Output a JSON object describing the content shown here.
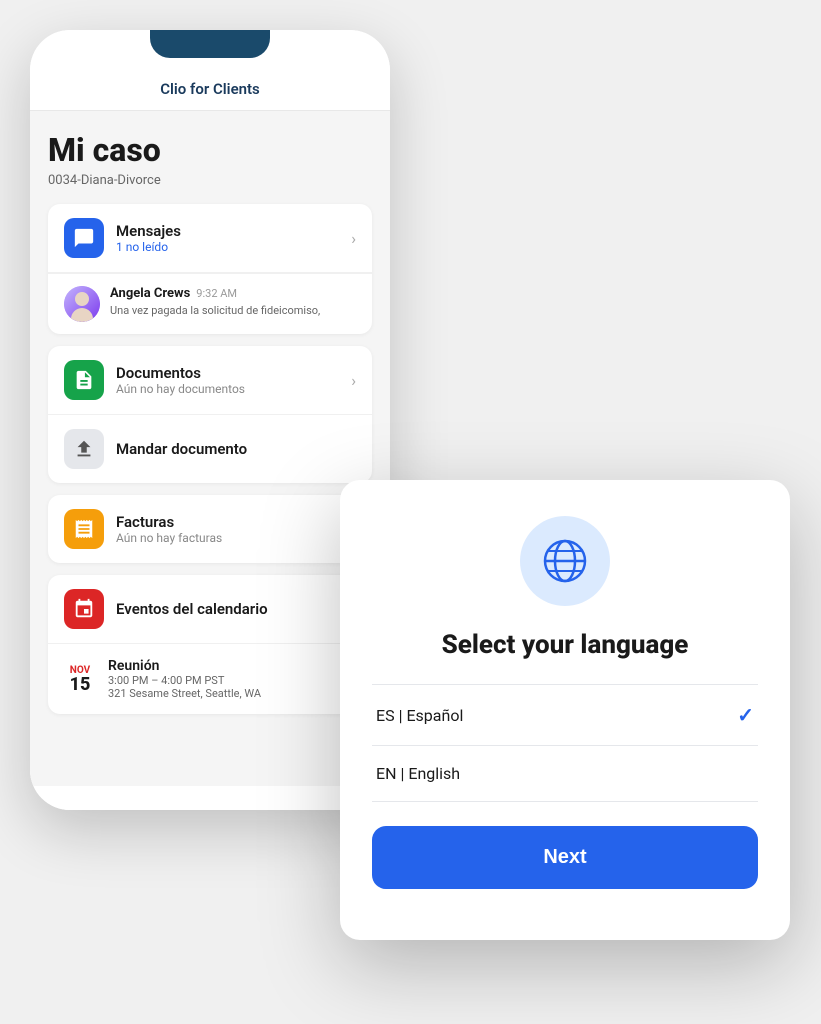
{
  "phone": {
    "header_title": "Clio for Clients",
    "case_title": "Mi caso",
    "case_subtitle": "0034-Diana-Divorce",
    "cards": {
      "mensajes": {
        "title": "Mensajes",
        "subtitle": "1 no leído",
        "icon": "💬",
        "icon_class": "icon-blue"
      },
      "message_preview": {
        "name": "Angela Crews",
        "time": "9:32 AM",
        "text": "Una vez pagada la solicitud de fideicomiso,"
      },
      "documentos": {
        "title": "Documentos",
        "subtitle": "Aún no hay documentos",
        "icon": "📄",
        "icon_class": "icon-green"
      },
      "mandar": {
        "title": "Mandar documento",
        "icon": "⬆",
        "icon_class": "icon-gray"
      },
      "facturas": {
        "title": "Facturas",
        "subtitle": "Aún no hay facturas",
        "icon": "🧾",
        "icon_class": "icon-orange"
      },
      "eventos": {
        "title": "Eventos del calendario",
        "icon": "📅",
        "icon_class": "icon-red"
      },
      "reunion": {
        "title": "Reunión",
        "month": "Nov",
        "day": "15",
        "time": "3:00 PM – 4:00 PM PST",
        "address": "321 Sesame Street, Seattle, WA"
      }
    }
  },
  "modal": {
    "globe_icon": "globe",
    "title": "Select your language",
    "languages": [
      {
        "code": "ES",
        "label": "ES | Español",
        "selected": true
      },
      {
        "code": "EN",
        "label": "EN | English",
        "selected": false
      }
    ],
    "next_button_label": "Next"
  }
}
